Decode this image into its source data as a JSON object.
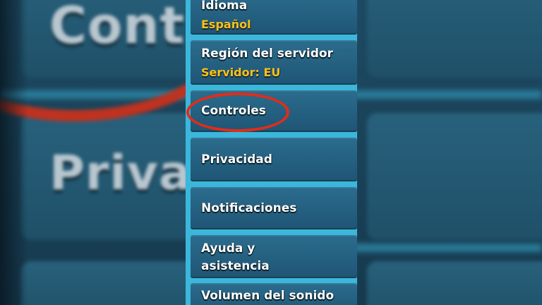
{
  "settings_menu": {
    "items": [
      {
        "label": "Idioma",
        "value": "Español"
      },
      {
        "label": "Región del servidor",
        "value": "Servidor: EU"
      },
      {
        "label": "Controles"
      },
      {
        "label": "Privacidad"
      },
      {
        "label": "Notificaciones"
      },
      {
        "label": "Ayuda y",
        "label2": "asistencia"
      },
      {
        "label": "Volumen del sonido"
      }
    ]
  },
  "background_echo": {
    "texts": [
      "Contro",
      "Privac"
    ]
  },
  "colors": {
    "accent_value": "#f7c21b",
    "highlight_ring": "#e02d1a",
    "item_bg": "#1f5575",
    "divider": "#3bb7dc"
  }
}
